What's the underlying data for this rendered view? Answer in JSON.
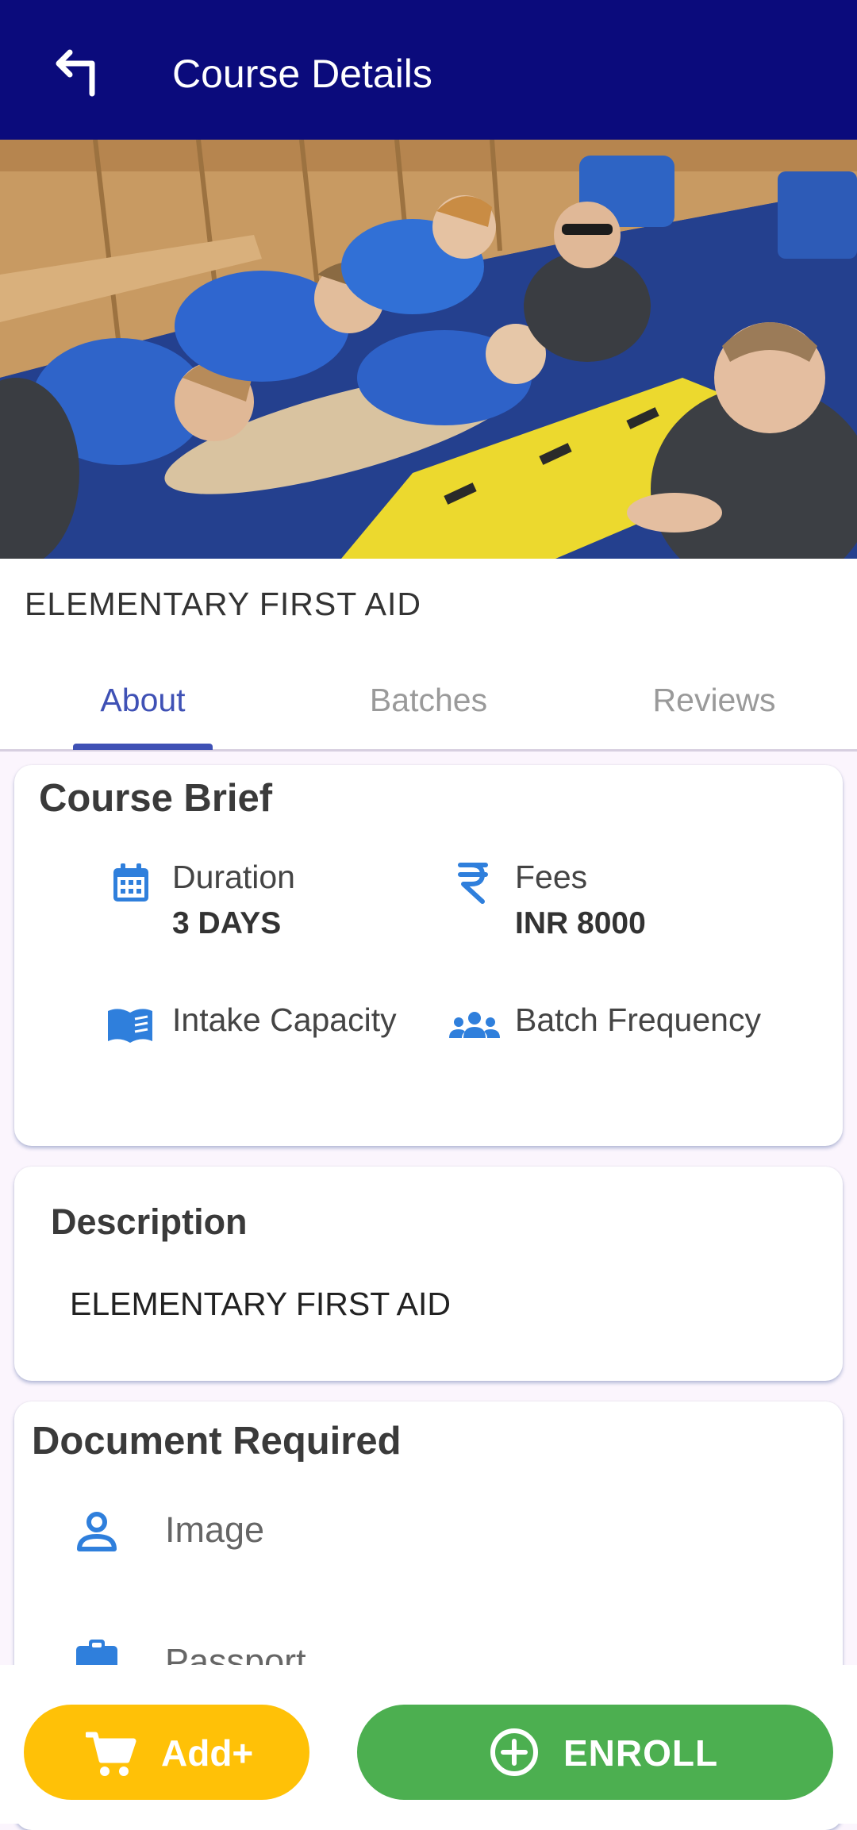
{
  "appbar": {
    "title": "Course Details"
  },
  "course": {
    "title": "ELEMENTARY FIRST AID"
  },
  "tabs": [
    {
      "label": "About",
      "active": true
    },
    {
      "label": "Batches",
      "active": false
    },
    {
      "label": "Reviews",
      "active": false
    }
  ],
  "course_brief": {
    "heading": "Course Brief",
    "duration": {
      "label": "Duration",
      "value": "3 DAYS",
      "icon": "calendar-icon"
    },
    "fees": {
      "label": "Fees",
      "value": "INR 8000",
      "icon": "rupee-icon"
    },
    "intake": {
      "label": "Intake Capacity",
      "icon": "book-icon"
    },
    "frequency": {
      "label": "Batch Frequency",
      "icon": "group-icon"
    }
  },
  "description": {
    "heading": "Description",
    "text": "ELEMENTARY FIRST AID"
  },
  "documents": {
    "heading": "Document Required",
    "items": [
      {
        "label": "Image",
        "icon": "person-icon"
      },
      {
        "label": "Passport",
        "icon": "clipboard-icon"
      }
    ]
  },
  "actions": {
    "add_label": "Add+",
    "enroll_label": "ENROLL"
  },
  "colors": {
    "appbar": "#0b0b7c",
    "accent": "#3f51b5",
    "icon_blue": "#2f7fdc",
    "add_button": "#ffc107",
    "enroll_button": "#4caf50"
  }
}
